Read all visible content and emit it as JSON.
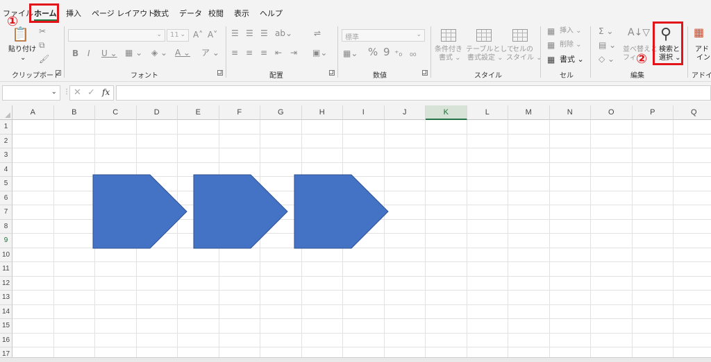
{
  "menu": {
    "tabs": [
      "ファイル",
      "ホーム",
      "挿入",
      "ページ レイアウト",
      "数式",
      "データ",
      "校閲",
      "表示",
      "ヘルプ"
    ],
    "active_tab": "ホーム"
  },
  "annotations": {
    "step1": "①",
    "step2": "②",
    "highlight_color": "#e3131a"
  },
  "ribbon": {
    "clipboard": {
      "label": "クリップボード",
      "paste_label": "貼り付け",
      "paste_caret": "⌄"
    },
    "font": {
      "label": "フォント",
      "font_size": "11"
    },
    "alignment": {
      "label": "配置"
    },
    "number": {
      "label": "数値",
      "format_value": "標準"
    },
    "styles": {
      "label": "スタイル",
      "conditional_format": [
        "条件付き",
        "書式 ⌄"
      ],
      "format_as_table": [
        "テーブルとして",
        "書式設定 ⌄"
      ],
      "cell_styles": [
        "セルの",
        "スタイル ⌄"
      ]
    },
    "cells": {
      "label": "セル",
      "insert": "挿入 ⌄",
      "delete": "削除 ⌄",
      "format": "書式 ⌄"
    },
    "editing": {
      "label": "編集",
      "sort_filter": [
        "並べ替えと",
        "フィ"
      ],
      "find_select": [
        "検索と",
        "選択 ⌄"
      ]
    },
    "addins": {
      "label": "アドイン",
      "button": [
        "アド",
        "イン"
      ]
    }
  },
  "formula_bar": {
    "name_box": "",
    "fx_label": "fx",
    "formula": ""
  },
  "sheet": {
    "columns": [
      "A",
      "B",
      "C",
      "D",
      "E",
      "F",
      "G",
      "H",
      "I",
      "J",
      "K",
      "L",
      "M",
      "N",
      "O",
      "P",
      "Q"
    ],
    "rows": [
      "1",
      "2",
      "3",
      "4",
      "5",
      "6",
      "7",
      "8",
      "9",
      "10",
      "11",
      "12",
      "13",
      "14",
      "15",
      "16",
      "17"
    ],
    "selected_column": "K",
    "selected_row": "9",
    "shape_color": "#4472c4",
    "shape_count": 3
  },
  "colors": {
    "accent": "#217346",
    "ribbon_bg": "#f3f3f3"
  }
}
